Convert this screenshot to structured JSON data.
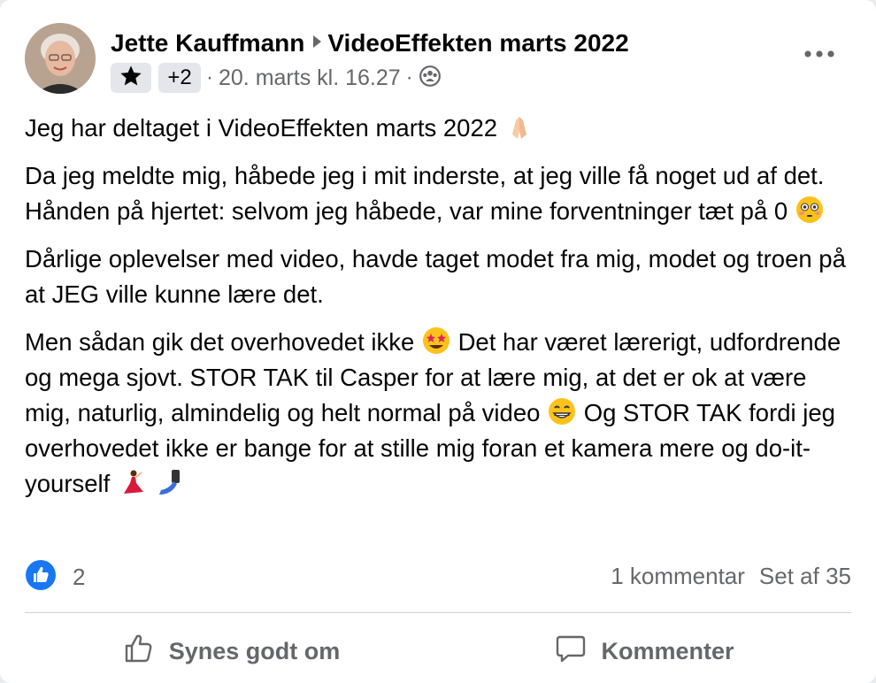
{
  "post": {
    "author": "Jette Kauffmann",
    "group": "VideoEffekten marts 2022",
    "badge_icon": "star-icon",
    "badge_extra": "+2",
    "separator": "·",
    "timestamp": "20. marts kl. 16.27",
    "audience_icon": "group-audience-icon",
    "paragraphs": {
      "p1": "Jeg har deltaget i VideoEffekten marts 2022",
      "p2": "Da jeg meldte mig, håbede jeg i mit inderste, at jeg ville få noget ud af det. Hånden på hjertet: selvom jeg håbede, var mine forventninger tæt på 0",
      "p3": "Dårlige oplevelser med video, havde taget modet fra mig, modet og troen på at JEG ville kunne lære det.",
      "p4a": "Men sådan gik det overhovedet ikke",
      "p4b": "Det har været lærerigt, udfordrende og mega sjovt. STOR TAK til Casper for at lære mig, at det er ok at være mig, naturlig, almindelig og helt normal på video",
      "p4c": "Og STOR TAK fordi jeg overhovedet ikke er bange for at stille mig foran et kamera mere og do-it-yourself"
    }
  },
  "stats": {
    "like_count": "2",
    "comments": "1 kommentar",
    "seen": "Set af 35"
  },
  "actions": {
    "like": "Synes godt om",
    "comment": "Kommenter"
  },
  "colors": {
    "text": "#050505",
    "secondary": "#65676b",
    "like_blue": "#1877f2",
    "divider": "#ced0d4"
  }
}
